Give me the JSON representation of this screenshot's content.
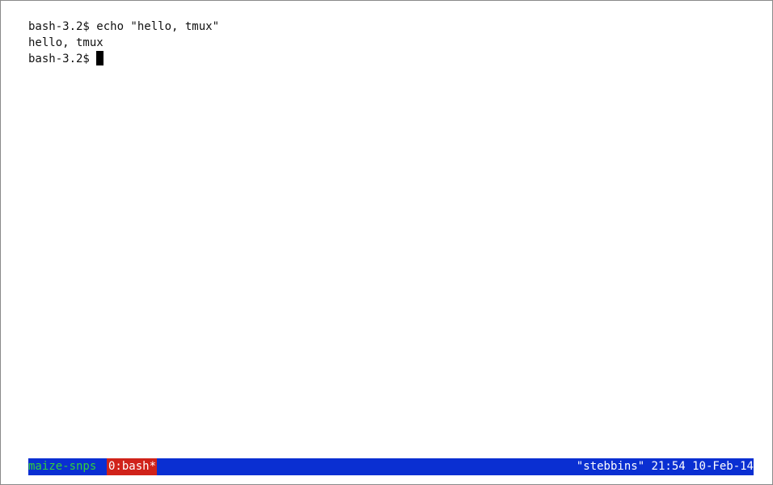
{
  "terminal": {
    "lines": [
      "bash-3.2$ echo \"hello, tmux\"",
      "hello, tmux",
      "bash-3.2$"
    ]
  },
  "status_bar": {
    "session_name": "maize-snps",
    "window_tab": "0:bash*",
    "right_text": "\"stebbins\" 21:54 10-Feb-14"
  },
  "colors": {
    "status_bg": "#0a2fd2",
    "session_fg": "#33d13a",
    "active_window_bg": "#d0221a"
  }
}
